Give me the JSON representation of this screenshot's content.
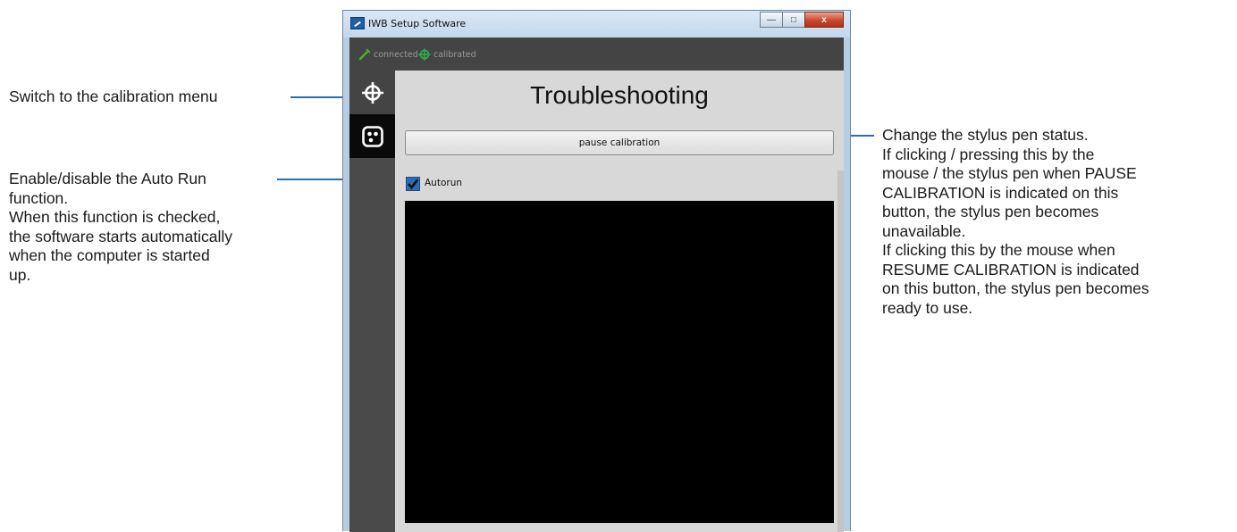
{
  "window": {
    "title": "IWB Setup Software",
    "controls": {
      "minimize": "—",
      "maximize": "□",
      "close": "x"
    }
  },
  "status": {
    "connected_label": "connected",
    "calibrated_label": "calibrated",
    "connected_color": "#4caf2a",
    "calibrated_color": "#2fa84f"
  },
  "sidebar": {
    "items": [
      {
        "icon": "crosshair-icon",
        "active": true
      },
      {
        "icon": "camera-dots-icon",
        "active": false
      }
    ]
  },
  "main": {
    "heading": "Troubleshooting",
    "pause_button": "pause calibration",
    "autorun_label": "Autorun",
    "autorun_checked": true
  },
  "callouts": {
    "calibration_menu": [
      "Switch to the calibration menu"
    ],
    "autorun": [
      "Enable/disable the Auto Run",
      "function.",
      "When this function is checked,",
      "the software starts automatically",
      "when the computer is started",
      "up."
    ],
    "pause": [
      "Change the stylus pen status.",
      "If clicking / pressing this by the",
      "mouse / the stylus pen when PAUSE",
      "CALIBRATION is indicated on this",
      "button, the stylus pen becomes",
      "unavailable.",
      "If clicking this by the mouse when",
      "RESUME CALIBRATION is indicated",
      "on this button, the stylus pen becomes",
      "ready to use."
    ]
  },
  "colors": {
    "leader": "#2a6fb0",
    "accent": "#2b6cb4"
  }
}
